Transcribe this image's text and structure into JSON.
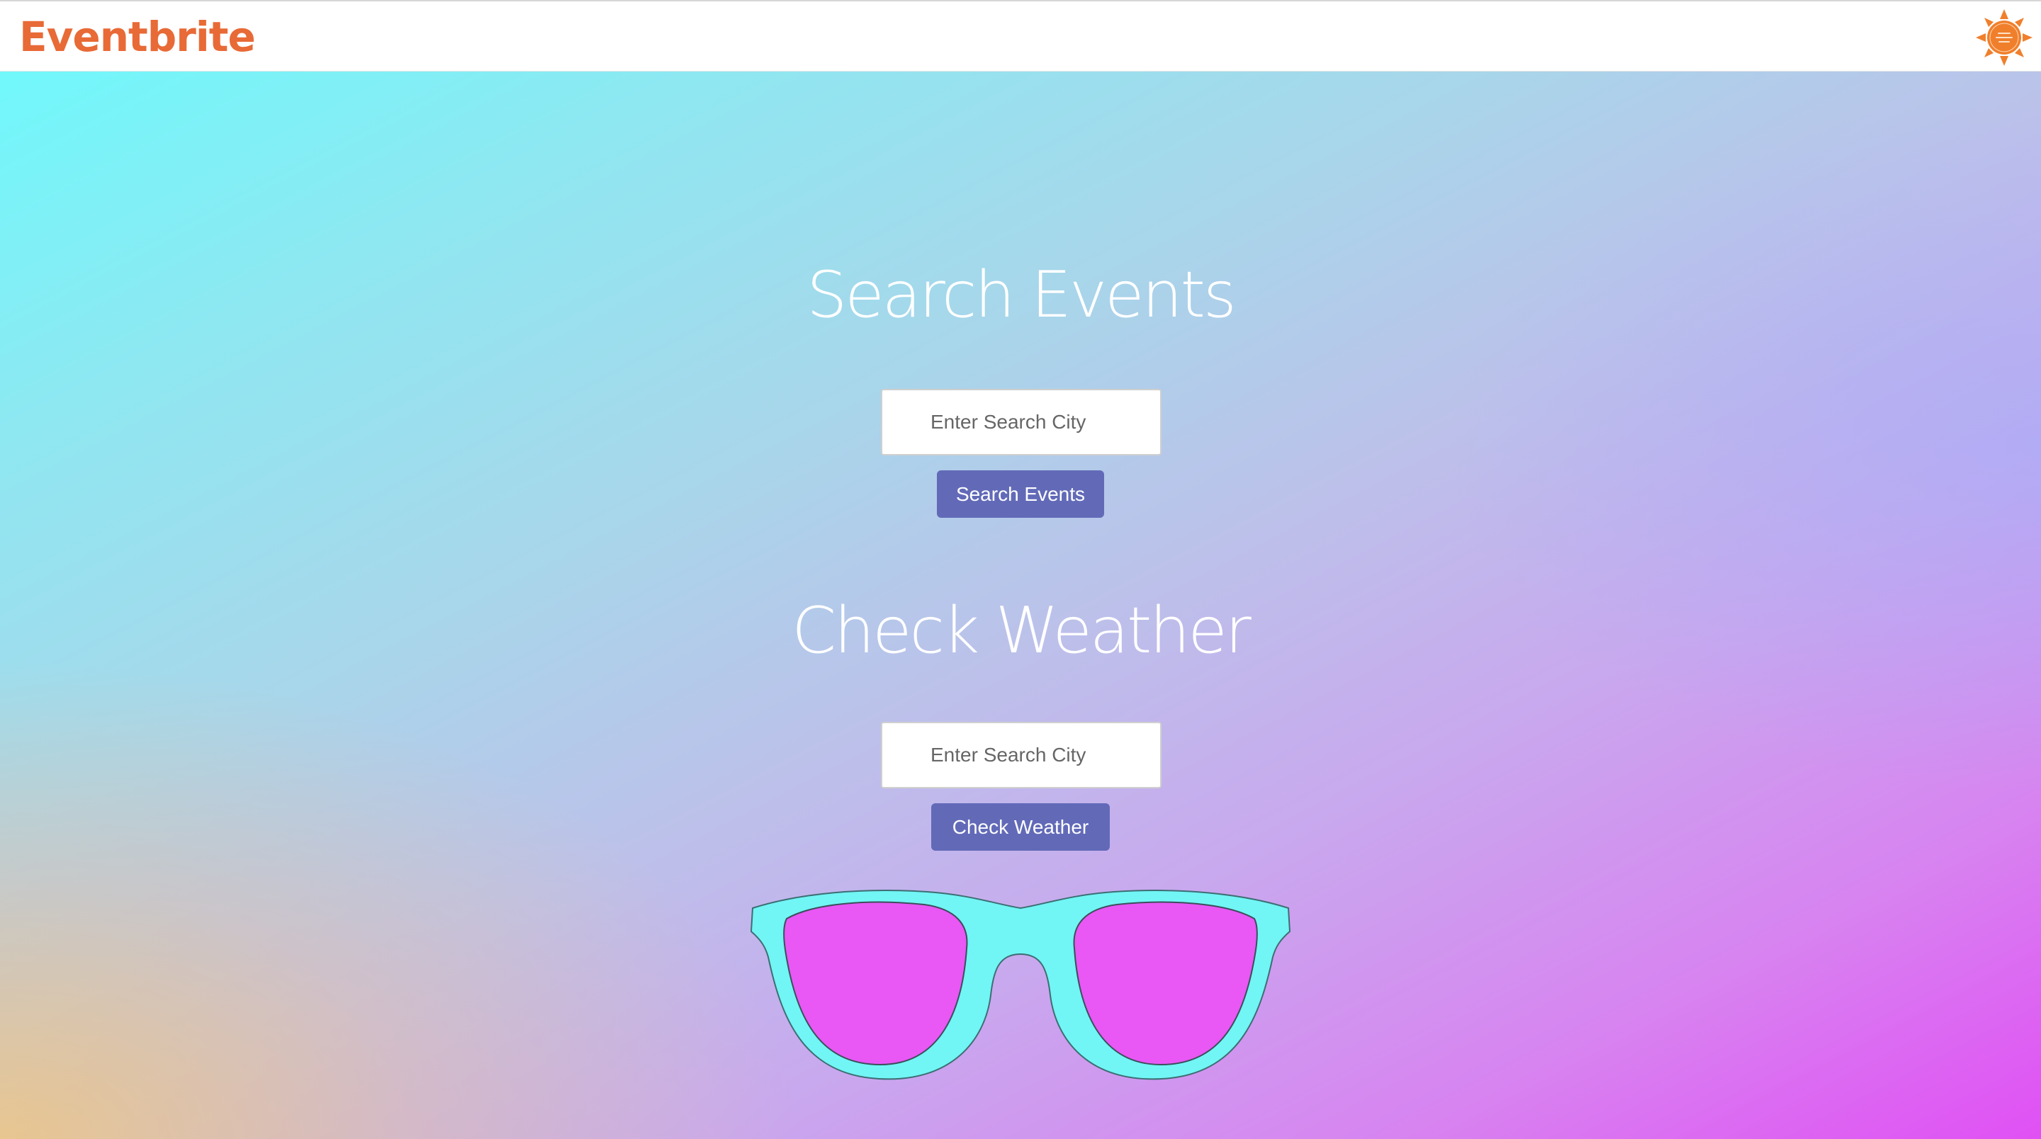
{
  "navbar": {
    "brand": "Eventbrite",
    "brand_color": "#e86a36",
    "logo_icon": "sun-logo-icon",
    "logo_color": "#f07f2c"
  },
  "events": {
    "title": "Search Events",
    "input_placeholder": "Enter Search City",
    "button_label": "Search Events"
  },
  "weather": {
    "title": "Check Weather",
    "input_placeholder": "Enter Search City",
    "button_label": "Check Weather"
  },
  "decoration": {
    "icon": "sunglasses-icon",
    "frame_color": "#71f5f5",
    "lens_color": "#e957f5"
  },
  "colors": {
    "button_bg": "#626ab8",
    "gradient_top": "#71f8fb",
    "gradient_bottom_right": "#e050f4",
    "gradient_bottom_left": "#f0c680"
  }
}
